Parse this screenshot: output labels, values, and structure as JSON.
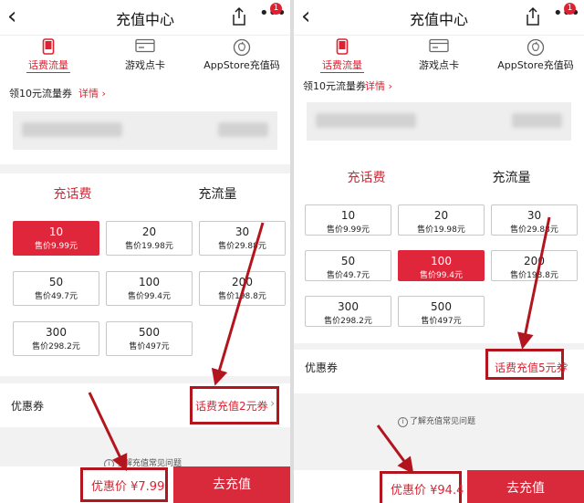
{
  "colors": {
    "accent": "#e02030",
    "annotation": "#b2151e"
  },
  "header": {
    "title": "充值中心",
    "back_icon": "chevron-left-icon",
    "share_icon": "share-icon",
    "more_icon": "more-icon",
    "badge": "1"
  },
  "tabs": [
    {
      "label": "话费流量",
      "icon": "phone-icon",
      "active": true
    },
    {
      "label": "游戏点卡",
      "icon": "card-icon",
      "active": false
    },
    {
      "label": "AppStore充值码",
      "icon": "apple-icon",
      "active": false
    }
  ],
  "promo": {
    "text": "领10元流量券",
    "link": "详情 ›"
  },
  "segments": {
    "left": "充话费",
    "right": "充流量"
  },
  "options": [
    {
      "value": "10",
      "price": "售价9.99元"
    },
    {
      "value": "20",
      "price": "售价19.98元"
    },
    {
      "value": "30",
      "price": "售价29.88元"
    },
    {
      "value": "50",
      "price": "售价49.7元"
    },
    {
      "value": "100",
      "price": "售价99.4元"
    },
    {
      "value": "200",
      "price": "售价198.8元"
    },
    {
      "value": "300",
      "price": "售价298.2元"
    },
    {
      "value": "500",
      "price": "售价497元"
    }
  ],
  "left": {
    "segment_active": "left",
    "selected": "10",
    "coupon_label": "优惠券",
    "coupon_value": "话费充值2元券",
    "help": "了解充值常见问题",
    "price": "优惠价 ¥7.99",
    "button": "去充值"
  },
  "right": {
    "segment_active": "left",
    "selected": "100",
    "coupon_label": "优惠券",
    "coupon_value": "话费充值5元券",
    "help": "了解充值常见问题",
    "price": "优惠价 ¥94.4",
    "button": "去充值"
  }
}
